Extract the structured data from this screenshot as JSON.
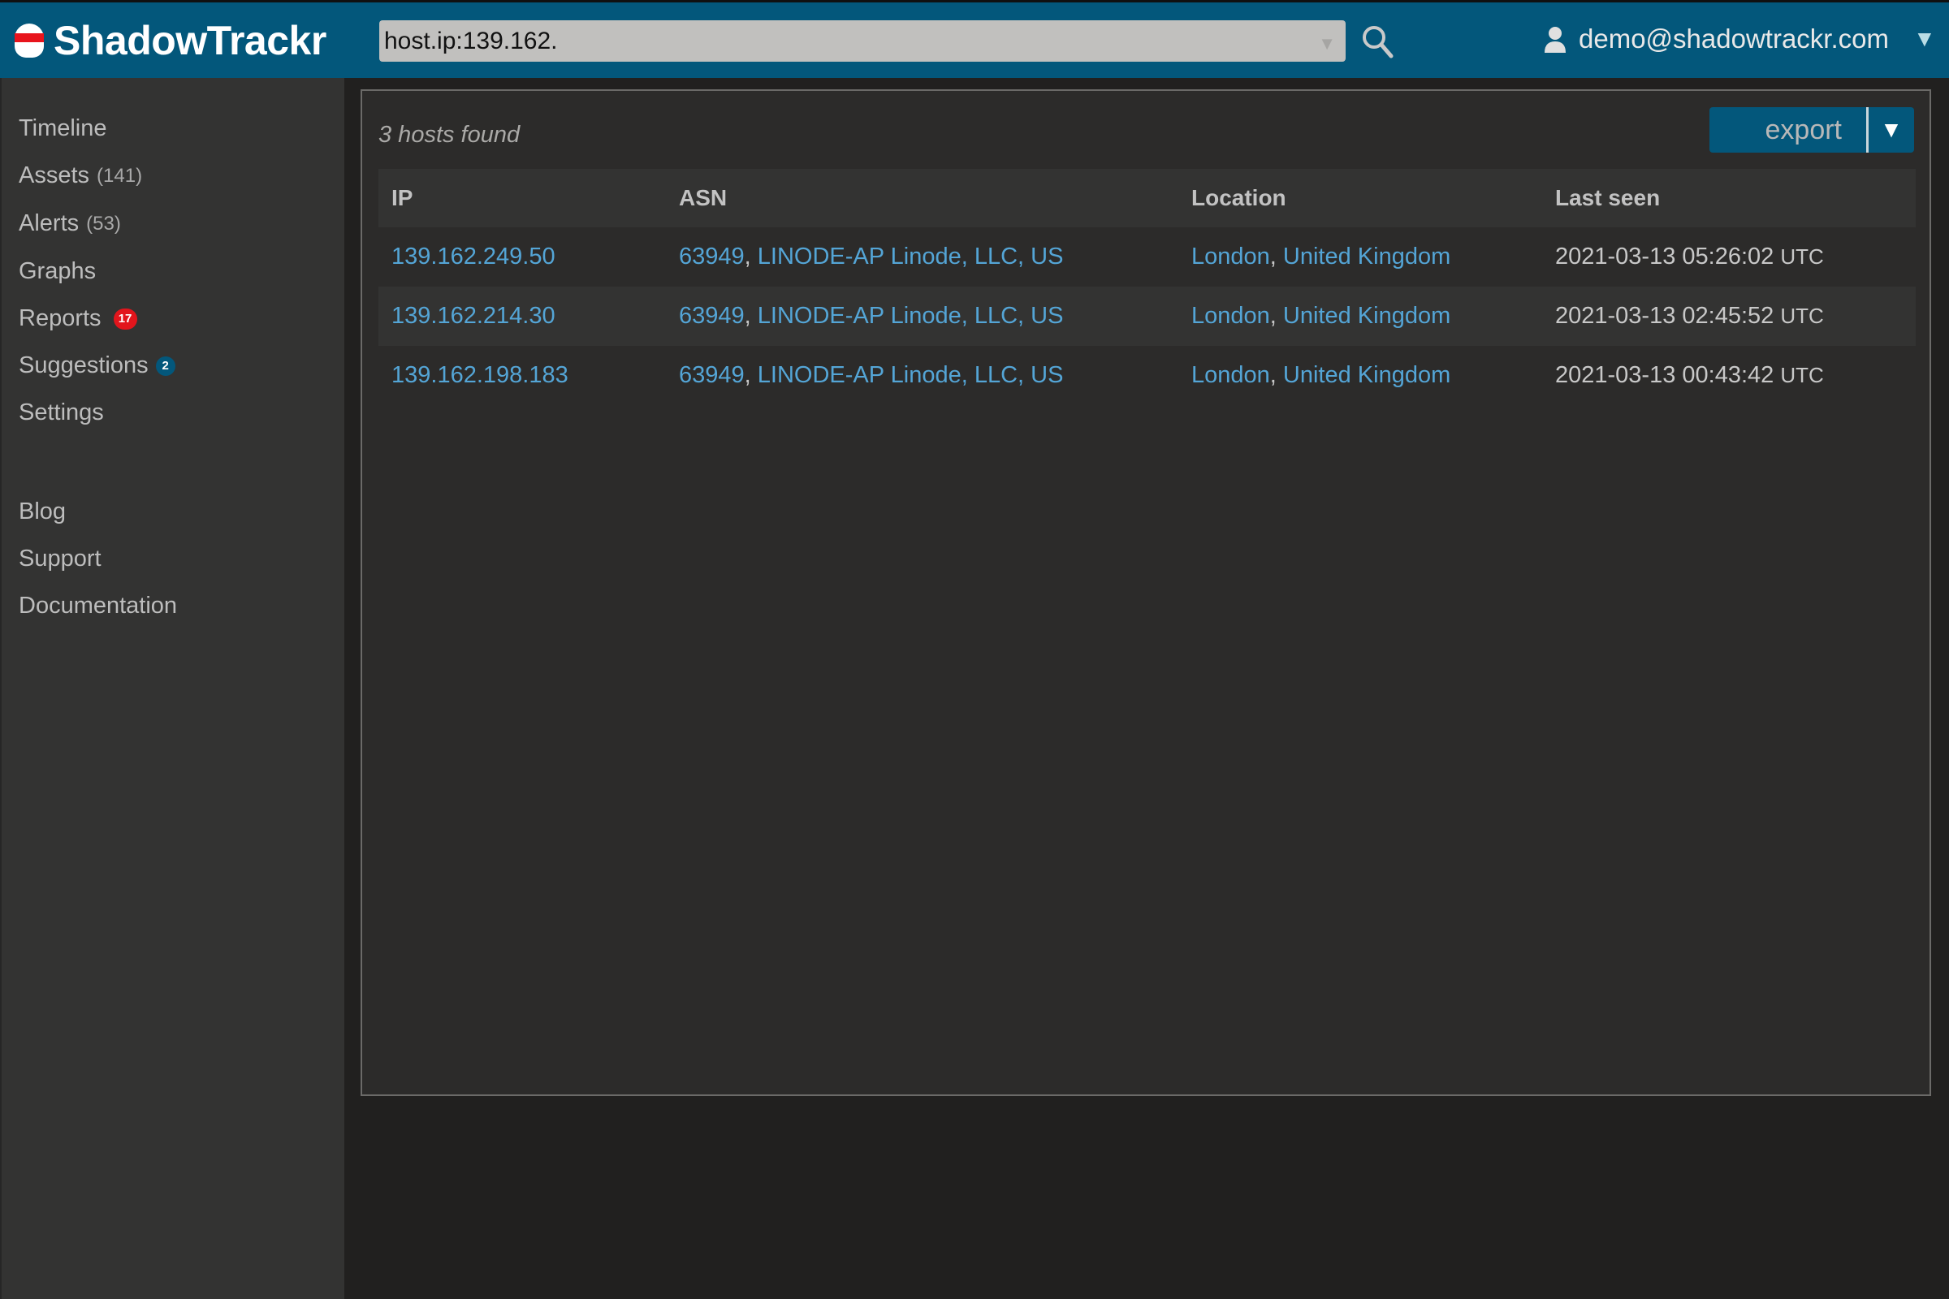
{
  "app": {
    "name": "ShadowTrackr",
    "brand_color": "#03577b",
    "accent_link_color": "#54a5d6",
    "alert_badge_color": "#e2151c"
  },
  "header": {
    "search": {
      "value": "host.ip:139.162.",
      "icon": "search-icon",
      "dropdown_icon": "caret-down-icon"
    },
    "user": {
      "icon": "user-icon",
      "email": "demo@shadowtrackr.com",
      "menu_icon": "caret-down-icon"
    }
  },
  "sidebar": {
    "items": [
      {
        "label": "Timeline"
      },
      {
        "label": "Assets",
        "count": "(141)"
      },
      {
        "label": "Alerts",
        "count": "(53)"
      },
      {
        "label": "Graphs"
      },
      {
        "label": "Reports",
        "badge": "17"
      },
      {
        "label": "Suggestions",
        "badge": "2"
      },
      {
        "label": "Settings"
      }
    ],
    "links": [
      {
        "label": "Blog"
      },
      {
        "label": "Support"
      },
      {
        "label": "Documentation"
      }
    ]
  },
  "main": {
    "results_summary": "3 hosts found",
    "export_label": "export",
    "export_menu_icon": "caret-down-icon",
    "table": {
      "columns": [
        "IP",
        "ASN",
        "Location",
        "Last seen"
      ],
      "rows": [
        {
          "ip": "139.162.249.50",
          "asn_number": "63949",
          "asn_name": "LINODE-AP Linode, LLC, US",
          "city": "London",
          "country": "United Kingdom",
          "last_seen": "2021-03-13 05:26:02",
          "tz": "UTC"
        },
        {
          "ip": "139.162.214.30",
          "asn_number": "63949",
          "asn_name": "LINODE-AP Linode, LLC, US",
          "city": "London",
          "country": "United Kingdom",
          "last_seen": "2021-03-13 02:45:52",
          "tz": "UTC"
        },
        {
          "ip": "139.162.198.183",
          "asn_number": "63949",
          "asn_name": "LINODE-AP Linode, LLC, US",
          "city": "London",
          "country": "United Kingdom",
          "last_seen": "2021-03-13 00:43:42",
          "tz": "UTC"
        }
      ]
    }
  }
}
